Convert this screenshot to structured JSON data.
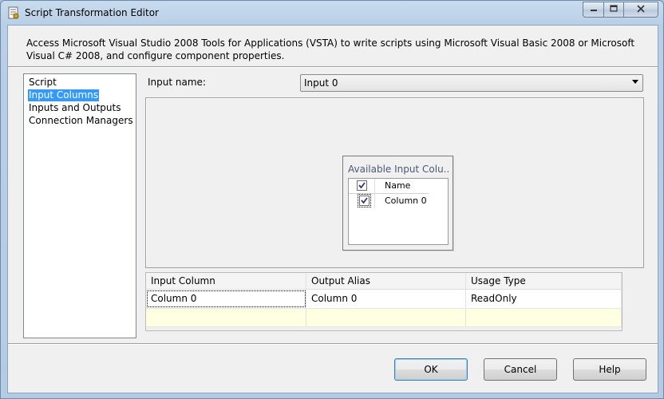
{
  "window": {
    "title": "Script Transformation Editor"
  },
  "description": "Access Microsoft Visual Studio 2008 Tools for Applications (VSTA) to write scripts using Microsoft Visual Basic 2008 or Microsoft Visual C# 2008, and configure component properties.",
  "nav": {
    "items": [
      {
        "label": "Script",
        "selected": false
      },
      {
        "label": "Input Columns",
        "selected": true
      },
      {
        "label": "Inputs and Outputs",
        "selected": false
      },
      {
        "label": "Connection Managers",
        "selected": false
      }
    ]
  },
  "input": {
    "label": "Input name:",
    "value": "Input 0"
  },
  "panel": {
    "title": "Available Input Colu...",
    "header_label": "Name",
    "header_checked": true,
    "rows": [
      {
        "label": "Column 0",
        "checked": true
      }
    ]
  },
  "grid": {
    "columns": [
      "Input Column",
      "Output Alias",
      "Usage Type"
    ],
    "rows": [
      [
        "Column 0",
        "Column 0",
        "ReadOnly"
      ]
    ]
  },
  "buttons": {
    "ok": "OK",
    "cancel": "Cancel",
    "help": "Help"
  },
  "colors": {
    "selection": "#3399ff",
    "new_row": "#ffffe1",
    "accent": "#3c7fb1"
  },
  "icons": {
    "app": "script-component-icon",
    "minimize": "minimize-icon",
    "maximize": "maximize-icon",
    "close": "close-icon",
    "dropdown": "chevron-down-icon",
    "check": "checkmark-icon"
  }
}
